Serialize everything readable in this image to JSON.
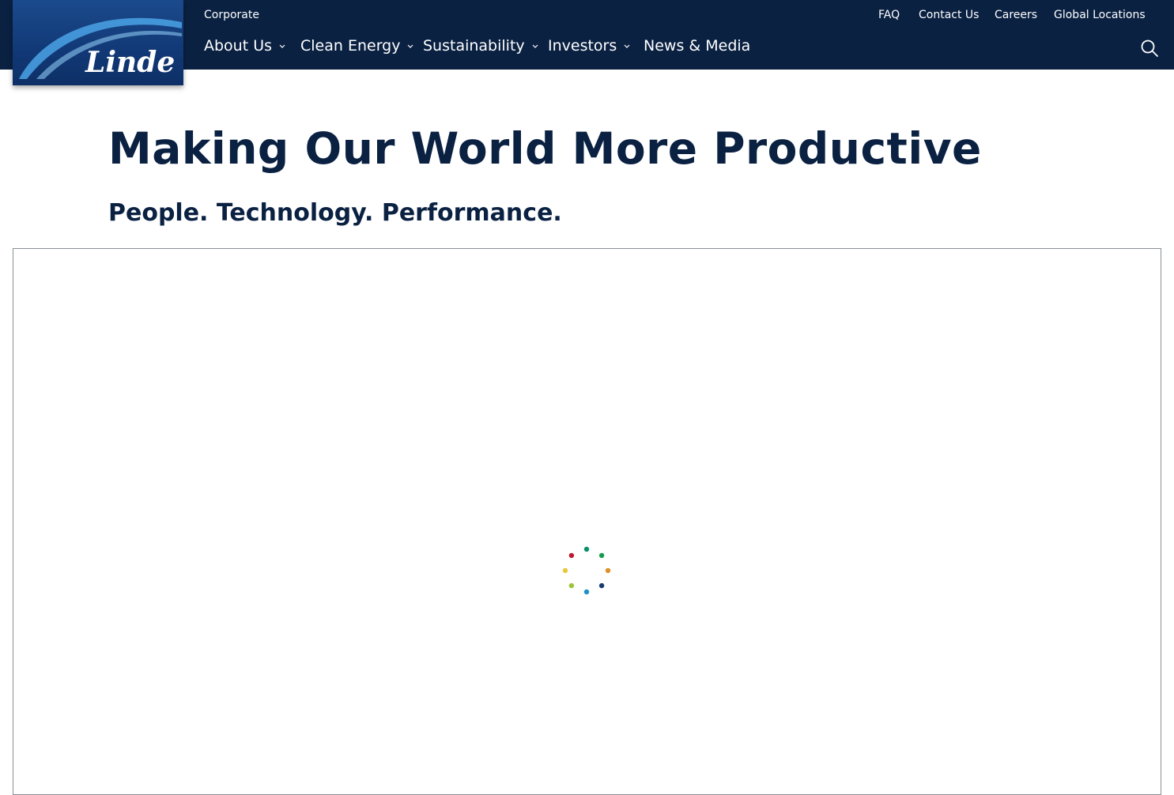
{
  "brand": {
    "logo_text": "Linde",
    "site_label": "Corporate"
  },
  "utility_nav": [
    {
      "label": "FAQ"
    },
    {
      "label": "Contact Us"
    },
    {
      "label": "Careers"
    },
    {
      "label": "Global Locations"
    }
  ],
  "main_nav": [
    {
      "label": "About Us",
      "has_dropdown": true
    },
    {
      "label": "Clean Energy",
      "has_dropdown": true
    },
    {
      "label": "Sustainability",
      "has_dropdown": true
    },
    {
      "label": "Investors",
      "has_dropdown": true
    },
    {
      "label": "News & Media",
      "has_dropdown": false
    }
  ],
  "search": {
    "icon": "search-icon"
  },
  "hero": {
    "headline": "Making Our World More Productive",
    "subheadline": "People. Technology. Performance."
  },
  "media": {
    "state": "loading",
    "spinner_icon": "loading-spinner-icon",
    "spinner_colors": [
      "#0a8f6a",
      "#139c4a",
      "#e0902a",
      "#163a6e",
      "#1a93c4",
      "#9bc43a",
      "#e8c93a",
      "#c0182e"
    ]
  },
  "colors": {
    "header_bg": "#0a2142",
    "text_dark": "#0a2142",
    "logo_bg": "#123a78"
  }
}
